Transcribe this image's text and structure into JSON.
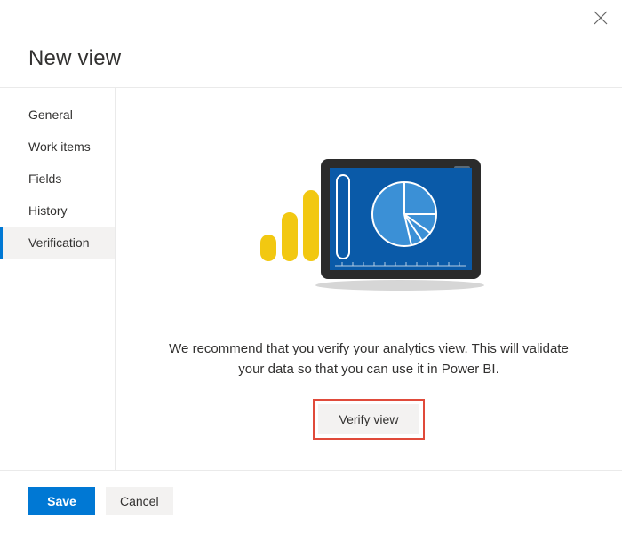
{
  "header": {
    "title": "New view"
  },
  "sidebar": {
    "items": [
      {
        "label": "General"
      },
      {
        "label": "Work items"
      },
      {
        "label": "Fields"
      },
      {
        "label": "History"
      },
      {
        "label": "Verification"
      }
    ],
    "selected_index": 4
  },
  "main": {
    "recommend_text": "We recommend that you verify your analytics view. This will validate your data so that you can use it in Power BI.",
    "verify_label": "Verify view"
  },
  "footer": {
    "save_label": "Save",
    "cancel_label": "Cancel"
  },
  "icons": {
    "close": "close-icon"
  }
}
